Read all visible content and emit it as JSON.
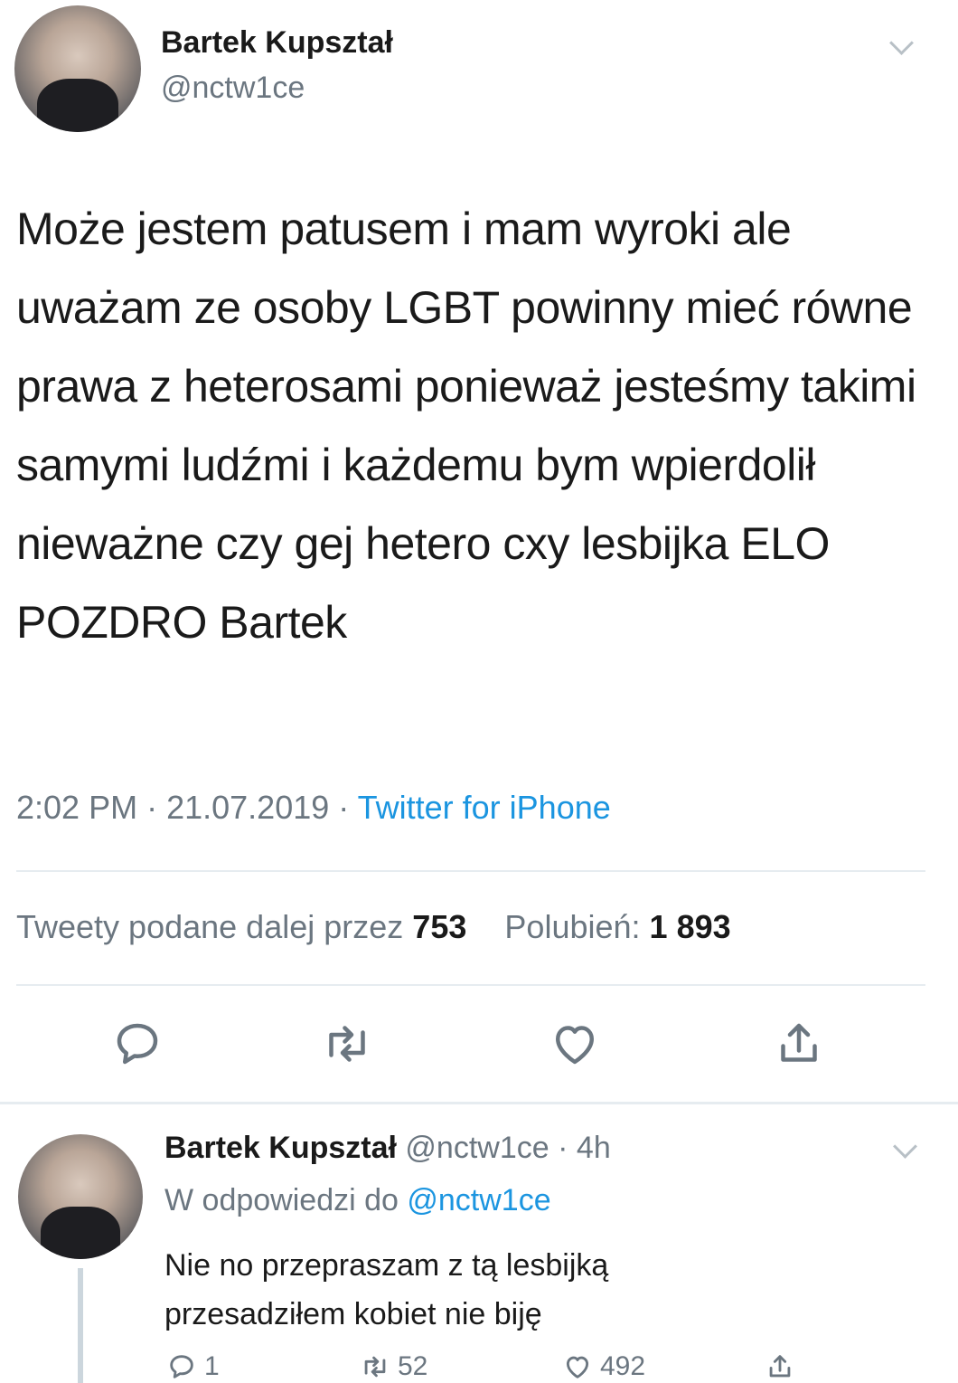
{
  "tweet": {
    "author_name": "Bartek Kupształ",
    "author_handle": "@nctw1ce",
    "text": "Może jestem patusem i mam wyroki ale uważam ze osoby LGBT powinny mieć równe prawa z heterosami ponieważ jesteśmy takimi samymi ludźmi i każdemu bym wpierdolił nieważne czy gej hetero cxy lesbijka ELO POZDRO Bartek",
    "time": "2:02 PM",
    "date": "21.07.2019",
    "source": "Twitter for iPhone",
    "retweets_label": "Tweety podane dalej przez",
    "retweets_count": "753",
    "likes_label": "Polubień:",
    "likes_count": "1 893",
    "actions": {
      "reply_icon": "reply-icon",
      "retweet_icon": "retweet-icon",
      "like_icon": "heart-icon",
      "share_icon": "share-icon"
    }
  },
  "reply": {
    "author_name": "Bartek Kupształ",
    "author_handle": "@nctw1ce",
    "age": "4h",
    "in_reply_to_label": "W odpowiedzi do",
    "in_reply_to_handle": "@nctw1ce",
    "text_line1": "Nie no przepraszam z tą lesbijką",
    "text_line2": "przesadziłem kobiet nie biję",
    "reply_count": "1",
    "retweet_count": "52",
    "like_count": "492"
  },
  "colors": {
    "link": "#1b95e0",
    "muted": "#6b7680",
    "divider": "#e6ecf0"
  }
}
